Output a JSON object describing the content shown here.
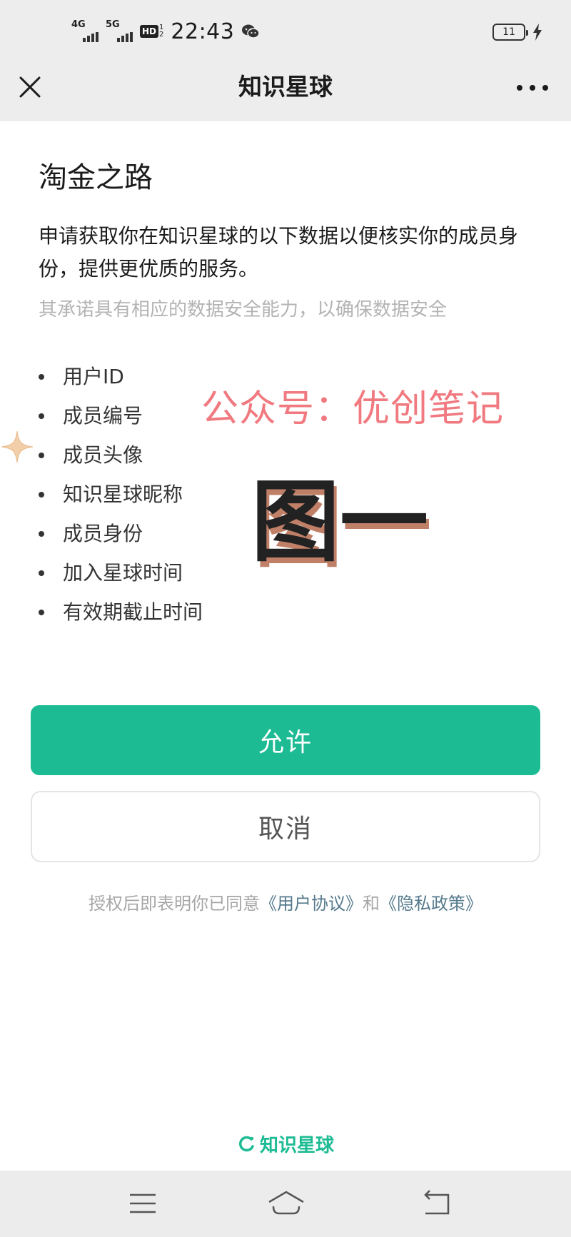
{
  "status_bar": {
    "network1": "4G",
    "network2": "5G",
    "hd_label": "HD",
    "hd_sub_top": "1",
    "hd_sub_bottom": "2",
    "time": "22:43",
    "battery_level": "11"
  },
  "header": {
    "title": "知识星球"
  },
  "main": {
    "app_name": "淘金之路",
    "description": "申请获取你在知识星球的以下数据以便核实你的成员身份，提供更优质的服务。",
    "note": "其承诺具有相应的数据安全能力，以确保数据安全",
    "permissions": [
      "用户ID",
      "成员编号",
      "成员头像",
      "知识星球昵称",
      "成员身份",
      "加入星球时间",
      "有效期截止时间"
    ]
  },
  "watermark": {
    "text": "公众号：优创笔记",
    "big_text": "图一",
    "color": "#f07a80"
  },
  "actions": {
    "allow_label": "允许",
    "cancel_label": "取消"
  },
  "agreement": {
    "prefix": "授权后即表明你已同意",
    "user_agreement": "《用户协议》",
    "and": "和",
    "privacy_policy": "《隐私政策》"
  },
  "footer": {
    "brand": "知识星球"
  },
  "colors": {
    "accent": "#1cbb93",
    "link": "#557a8c",
    "top_bg": "#ededed"
  }
}
